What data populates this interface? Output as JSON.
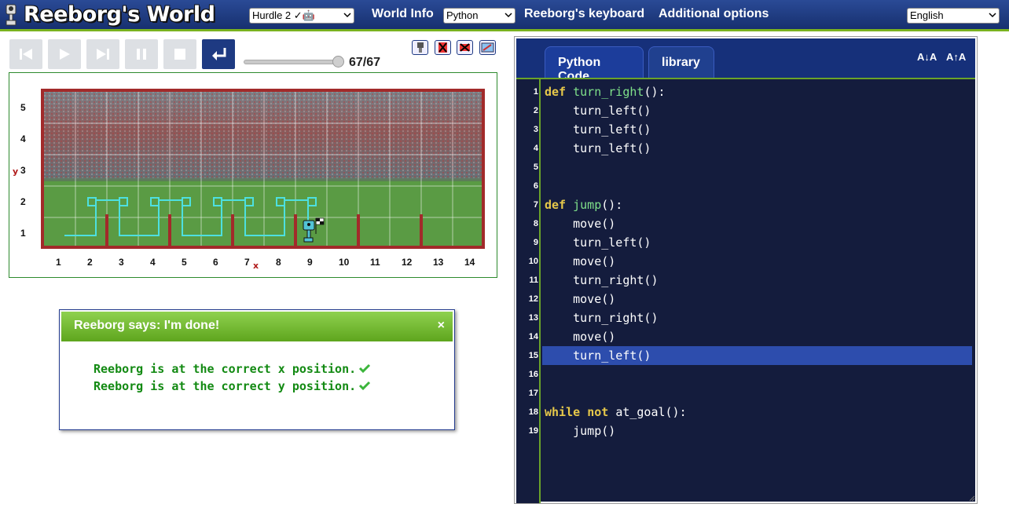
{
  "header": {
    "title": "Reeborg's World",
    "world_select": "Hurdle 2 ✓🤖",
    "world_info": "World Info",
    "language_select": "Python",
    "keyboard": "Reeborg's keyboard",
    "additional_options": "Additional options",
    "ui_language_select": "English"
  },
  "controls": {
    "step_display": "67/67",
    "playback_progress": 1.0
  },
  "world": {
    "x_axis_labels": [
      "1",
      "2",
      "3",
      "4",
      "5",
      "6",
      "7",
      "8",
      "9",
      "10",
      "11",
      "12",
      "13",
      "14"
    ],
    "y_axis_labels": [
      "1",
      "2",
      "3",
      "4",
      "5"
    ],
    "x_axis_title": "x",
    "y_axis_title": "y"
  },
  "dialog": {
    "title": "Reeborg says: I'm done!",
    "close": "×",
    "messages": [
      "Reeborg is at the correct x position.",
      "Reeborg is at the correct y position."
    ]
  },
  "editor": {
    "tab_python": "Python Code",
    "tab_library": "library",
    "font_decrease": "A↓A",
    "font_increase": "A↑A",
    "highlighted_line": 15,
    "line_numbers": [
      "1",
      "2",
      "3",
      "4",
      "5",
      "6",
      "7",
      "8",
      "9",
      "10",
      "11",
      "12",
      "13",
      "14",
      "15",
      "16",
      "17",
      "18",
      "19"
    ],
    "lines": [
      {
        "kw": "def ",
        "fn": "turn_right",
        "rest": "():"
      },
      {
        "indent": "    ",
        "rest": "turn_left()"
      },
      {
        "indent": "    ",
        "rest": "turn_left()"
      },
      {
        "indent": "    ",
        "rest": "turn_left()"
      },
      {},
      {},
      {
        "kw": "def ",
        "fn": "jump",
        "rest": "():"
      },
      {
        "indent": "    ",
        "rest": "move()"
      },
      {
        "indent": "    ",
        "rest": "turn_left()"
      },
      {
        "indent": "    ",
        "rest": "move()"
      },
      {
        "indent": "    ",
        "rest": "turn_right()"
      },
      {
        "indent": "    ",
        "rest": "move()"
      },
      {
        "indent": "    ",
        "rest": "turn_right()"
      },
      {
        "indent": "    ",
        "rest": "move()"
      },
      {
        "indent": "    ",
        "rest": "turn_left()"
      },
      {},
      {},
      {
        "kw": "while ",
        "kw2": "not ",
        "rest": "at_goal():"
      },
      {
        "indent": "    ",
        "rest": "jump()"
      }
    ]
  }
}
